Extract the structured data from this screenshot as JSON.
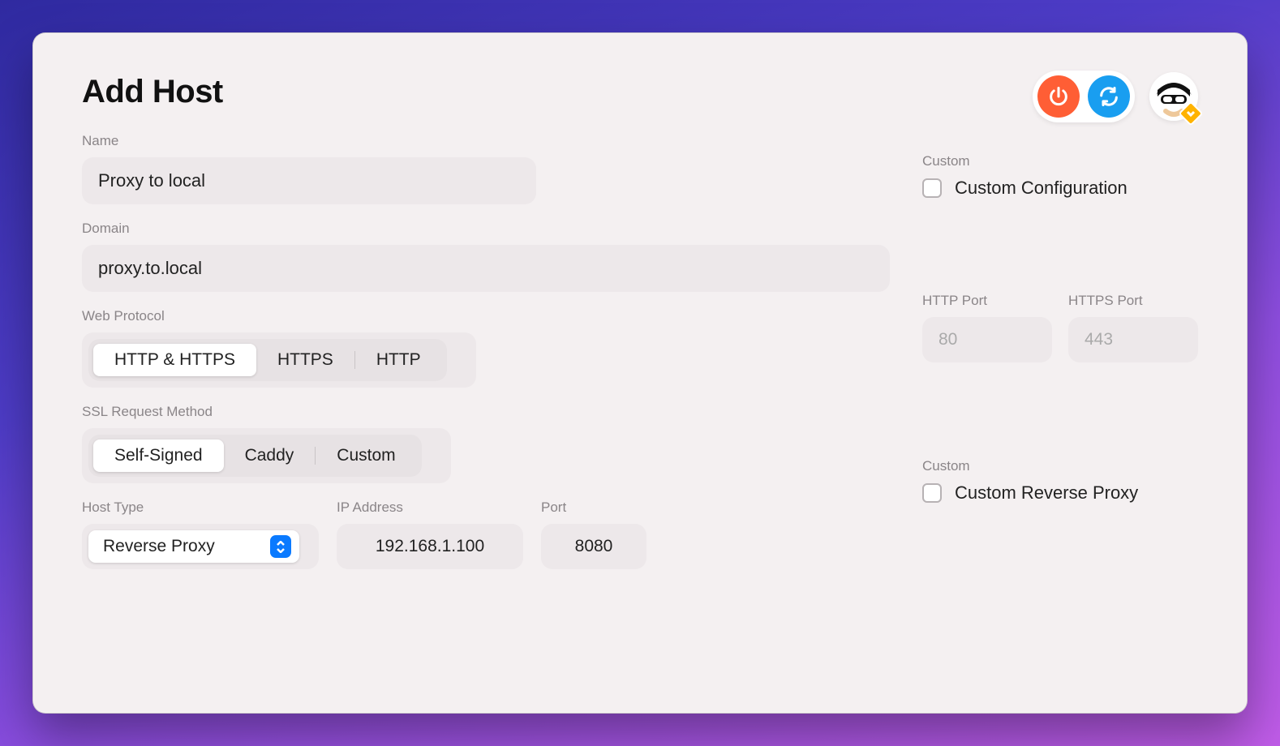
{
  "header": {
    "title": "Add Host"
  },
  "fields": {
    "name_label": "Name",
    "name_value": "Proxy to local",
    "domain_label": "Domain",
    "domain_value": "proxy.to.local",
    "protocol_label": "Web Protocol",
    "protocol_options": {
      "both": "HTTP & HTTPS",
      "https": "HTTPS",
      "http": "HTTP"
    },
    "ssl_label": "SSL Request Method",
    "ssl_options": {
      "self": "Self-Signed",
      "caddy": "Caddy",
      "custom": "Custom"
    },
    "hosttype_label": "Host Type",
    "hosttype_value": "Reverse Proxy",
    "ip_label": "IP Address",
    "ip_value": "192.168.1.100",
    "port_label": "Port",
    "port_value": "8080"
  },
  "right": {
    "custom_label": "Custom",
    "custom_config": "Custom Configuration",
    "http_port_label": "HTTP Port",
    "http_port_placeholder": "80",
    "https_port_label": "HTTPS Port",
    "https_port_placeholder": "443",
    "custom2_label": "Custom",
    "custom_rproxy": "Custom Reverse Proxy"
  }
}
